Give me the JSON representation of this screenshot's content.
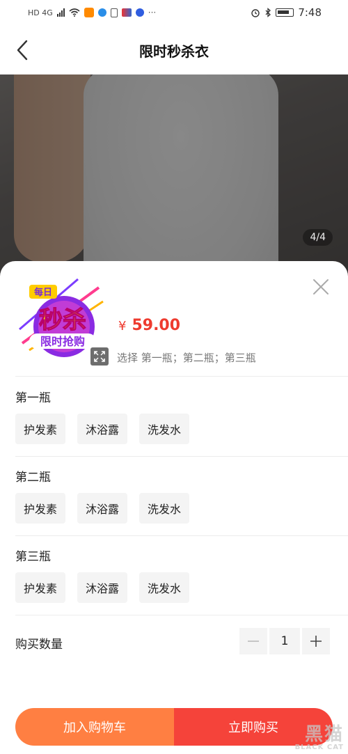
{
  "status_bar": {
    "network": "HD 4G",
    "time": "7:48"
  },
  "header": {
    "title": "限时秒杀衣"
  },
  "gallery": {
    "indicator": "4/4"
  },
  "sku_panel": {
    "price_symbol": "¥",
    "price": "59.00",
    "select_hint": "选择 第一瓶；第二瓶；第三瓶",
    "thumb_text": {
      "top": "每日",
      "middle": "秒杀",
      "bottom": "限时抢购"
    },
    "groups": [
      {
        "title": "第一瓶",
        "options": [
          "护发素",
          "沐浴露",
          "洗发水"
        ]
      },
      {
        "title": "第二瓶",
        "options": [
          "护发素",
          "沐浴露",
          "洗发水"
        ]
      },
      {
        "title": "第三瓶",
        "options": [
          "护发素",
          "沐浴露",
          "洗发水"
        ]
      }
    ],
    "quantity_label": "购买数量",
    "quantity": "1"
  },
  "actions": {
    "add_to_cart": "加入购物车",
    "buy_now": "立即购买"
  },
  "watermark": {
    "cn": "黑猫",
    "en": "BLACK CAT"
  },
  "colors": {
    "price": "#ee3b2f",
    "cart_button": "#ff7f42",
    "buy_button": "#f5433a"
  }
}
